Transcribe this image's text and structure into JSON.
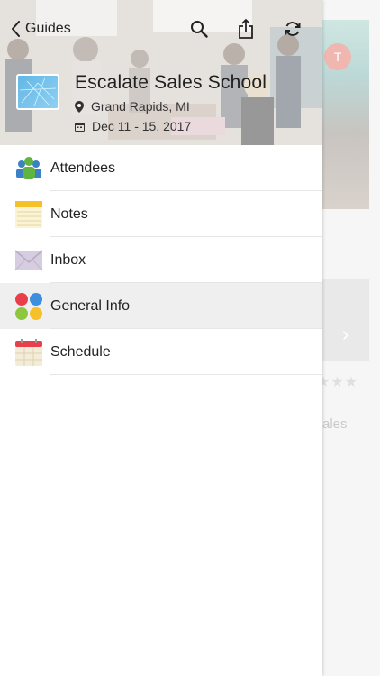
{
  "nav": {
    "back_label": "Guides",
    "back_icon": "chevron-left-icon",
    "actions": [
      {
        "name": "search",
        "icon": "search-icon"
      },
      {
        "name": "share",
        "icon": "share-icon"
      },
      {
        "name": "refresh",
        "icon": "refresh-icon"
      }
    ]
  },
  "event": {
    "title": "Escalate Sales School",
    "location": "Grand Rapids, MI",
    "dates": "Dec 11 - 15, 2017"
  },
  "menu": {
    "items": [
      {
        "label": "Attendees",
        "icon": "people-icon",
        "active": false
      },
      {
        "label": "Notes",
        "icon": "notepad-icon",
        "active": false
      },
      {
        "label": "Inbox",
        "icon": "envelope-icon",
        "active": false
      },
      {
        "label": "General Info",
        "icon": "colored-dots-icon",
        "active": true
      },
      {
        "label": "Schedule",
        "icon": "calendar-icon",
        "active": false
      }
    ]
  },
  "background": {
    "avatar_initial": "T",
    "text_fragment": "ales"
  },
  "colors": {
    "accent_blue": "#3b82c4",
    "dot_red": "#e8404a",
    "dot_blue": "#3a8fde",
    "dot_green": "#8dc63f",
    "dot_yellow": "#f5c02a",
    "active_row": "#efefef"
  }
}
